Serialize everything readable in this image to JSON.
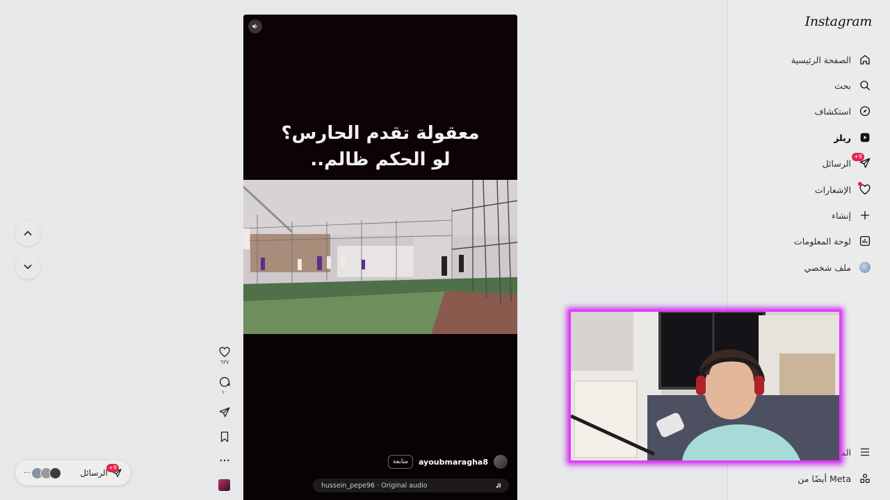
{
  "brand": {
    "logo": "Instagram"
  },
  "nav": {
    "home": "الصفحة الرئيسية",
    "search": "بحث",
    "explore": "استكشاف",
    "reels": "ريلز",
    "messages": "الرسائل",
    "messages_badge": "+9",
    "notifications": "الإشعارات",
    "create": "إنشاء",
    "dashboard": "لوحة المعلومات",
    "profile": "ملف شخصي",
    "more": "المزيد",
    "also_from_meta": "أيضًا من Meta"
  },
  "reel": {
    "caption_line1": "معقولة تقدم الحارس؟",
    "caption_line2": "لو الحكم ظالم..",
    "username": "ayoubmaragha8",
    "follow_label": "متابعة",
    "audio": "hussein_pepe96 · Original audio"
  },
  "actions": {
    "likes": "٦٣٧",
    "comments": "١٠"
  },
  "messages_pill": {
    "label": "الرسائل",
    "badge": "+9",
    "more": "···"
  },
  "colors": {
    "accent": "#e0244f",
    "webcam_border": "#e43cff"
  }
}
